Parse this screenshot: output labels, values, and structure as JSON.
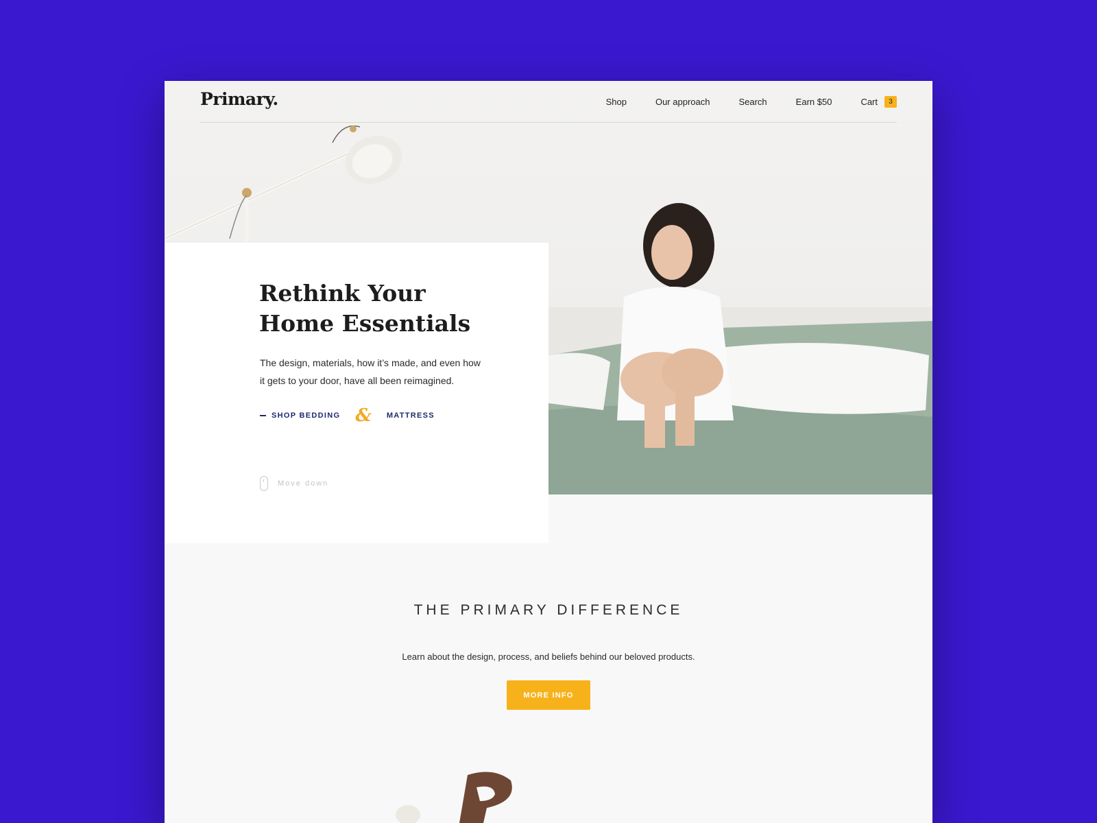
{
  "brand": {
    "logo": "Primary."
  },
  "nav": {
    "items": [
      "Shop",
      "Our approach",
      "Search",
      "Earn $50"
    ],
    "cart_label": "Cart",
    "cart_count": "3"
  },
  "hero": {
    "headline": "Rethink Your Home Essentials",
    "body": "The design, materials, how it’s made, and even how it gets to your door, have all been reimagined.",
    "link_bedding": "SHOP BEDDING",
    "ampersand": "&",
    "link_mattress": "MATTRESS",
    "scroll_hint": "Move down"
  },
  "difference": {
    "title": "THE PRIMARY DIFFERENCE",
    "text": "Learn about the design, process, and beliefs  behind our beloved products.",
    "button_label": "MORE INFO"
  },
  "colors": {
    "background": "#3a18cf",
    "accent": "#f7b21b",
    "link": "#1f2a6b",
    "bedding": "#9fb3a3"
  }
}
